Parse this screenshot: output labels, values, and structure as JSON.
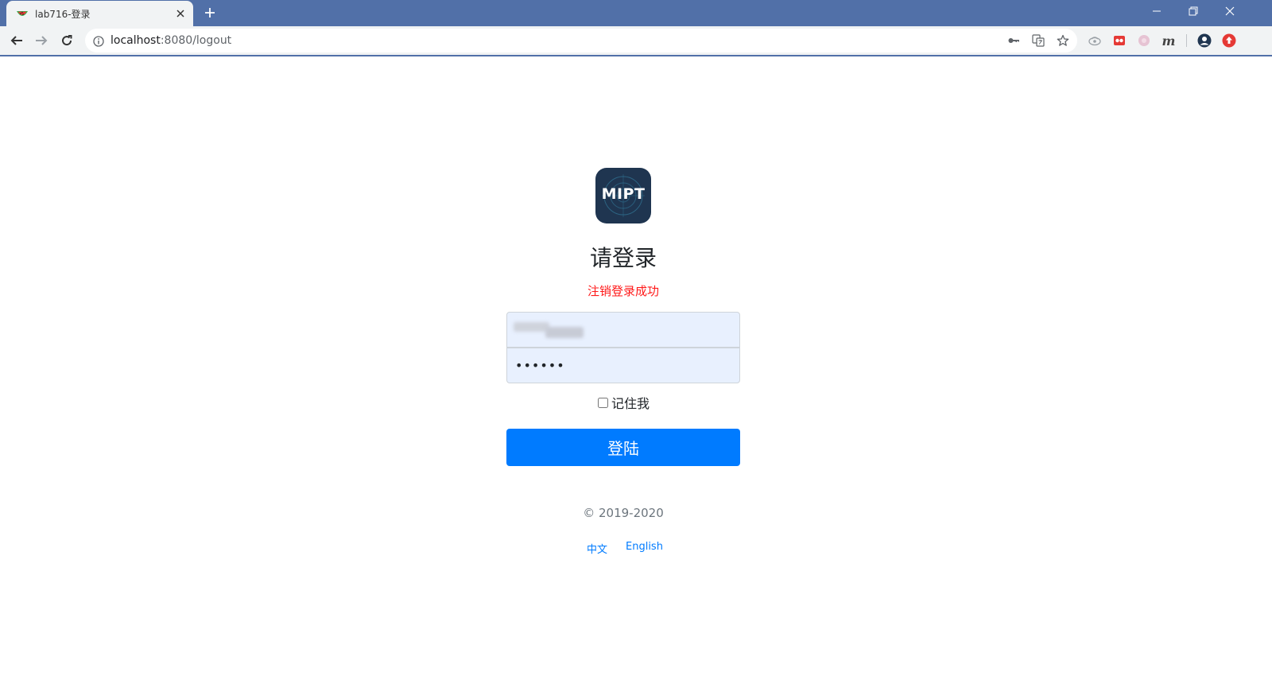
{
  "browser": {
    "tab": {
      "title": "lab716-登录",
      "favicon": "melon-favicon-icon",
      "close_icon": "close-icon"
    },
    "new_tab_icon": "plus-icon",
    "window_controls": [
      "minimize-icon",
      "restore-icon",
      "close-icon"
    ],
    "nav": [
      "back-arrow-icon",
      "forward-arrow-icon",
      "reload-icon"
    ],
    "address": {
      "host": "localhost",
      "rest": ":8080/logout"
    },
    "omnibox_icons": [
      "info-icon",
      "key-icon",
      "translate-icon",
      "star-icon"
    ],
    "extensions": [
      "extension-icon-1",
      "extension-icon-2",
      "extension-icon-3",
      "extension-icon-m",
      "profile-icon",
      "update-icon"
    ],
    "extension_letter": "m"
  },
  "page": {
    "logo_text": "MIPT",
    "heading": "请登录",
    "alert": "注销登录成功",
    "username": {
      "value": ""
    },
    "password": {
      "value": "••••••"
    },
    "remember_label": "记住我",
    "login_button": "登陆",
    "copyright": "© 2019-2020",
    "lang": {
      "zh": "中文",
      "en": "English"
    }
  },
  "colors": {
    "titlebar": "#5170a8",
    "toolbar": "#f1f3f4",
    "primary": "#007bff",
    "alert": "#ff1a1a",
    "input_bg": "#e8f0fe",
    "logo_bg": "#1f3550"
  }
}
